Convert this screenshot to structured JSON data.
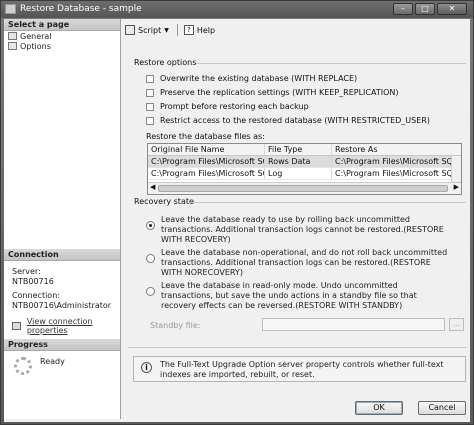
{
  "window": {
    "title": "Restore Database - sample"
  },
  "left": {
    "select_page_header": "Select a page",
    "pages": [
      {
        "label": "General"
      },
      {
        "label": "Options"
      }
    ],
    "connection_header": "Connection",
    "server_label": "Server:",
    "server_value": "NTB00716",
    "connection_label": "Connection:",
    "connection_value": "NTB00716\\Administrator",
    "view_link": "View connection properties",
    "progress_header": "Progress",
    "progress_status": "Ready"
  },
  "toolbar": {
    "script": "Script",
    "help": "Help"
  },
  "restore_options": {
    "label": "Restore options",
    "checks": [
      {
        "label": "Overwrite the existing database (WITH REPLACE)",
        "checked": false
      },
      {
        "label": "Preserve the replication settings (WITH KEEP_REPLICATION)",
        "checked": false
      },
      {
        "label": "Prompt before restoring each backup",
        "checked": false
      },
      {
        "label": "Restrict access to the restored database (WITH RESTRICTED_USER)",
        "checked": false
      }
    ]
  },
  "files": {
    "label": "Restore the database files as:",
    "columns": [
      "Original File Name",
      "File Type",
      "Restore As"
    ],
    "rows": [
      [
        "C:\\Program Files\\Microsoft SQL...",
        "Rows Data",
        "C:\\Program Files\\Microsoft SQL..."
      ],
      [
        "C:\\Program Files\\Microsoft SQL...",
        "Log",
        "C:\\Program Files\\Microsoft SQL..."
      ]
    ]
  },
  "recovery": {
    "label": "Recovery state",
    "options": [
      {
        "text": "Leave the database ready to use by rolling back uncommitted transactions. Additional transaction logs cannot be restored.(RESTORE WITH RECOVERY)",
        "selected": true
      },
      {
        "text": "Leave the database non-operational, and do not roll back uncommitted transactions. Additional transaction logs can be restored.(RESTORE WITH NORECOVERY)",
        "selected": false
      },
      {
        "text": "Leave the database in read-only mode. Undo uncommitted transactions, but save the undo actions in a standby file so that recovery effects can be reversed.(RESTORE WITH STANDBY)",
        "selected": false
      }
    ],
    "standby_label": "Standby file:",
    "standby_value": "",
    "browse": "..."
  },
  "info": {
    "text": "The Full-Text Upgrade Option server property controls whether full-text indexes are imported, rebuilt, or reset."
  },
  "buttons": {
    "ok": "OK",
    "cancel": "Cancel"
  }
}
